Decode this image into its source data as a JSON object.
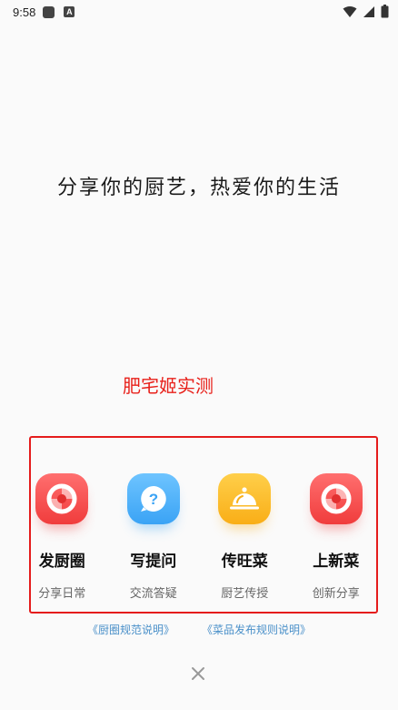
{
  "status_bar": {
    "time": "9:58",
    "notif_letter": "A"
  },
  "tagline": "分享你的厨艺，热爱你的生活",
  "watermark": "肥宅姬实测",
  "actions": [
    {
      "title": "发厨圈",
      "subtitle": "分享日常",
      "icon": "camera-aperture-icon",
      "color": "#f04848"
    },
    {
      "title": "写提问",
      "subtitle": "交流答疑",
      "icon": "question-bubble-icon",
      "color": "#3aa3f5"
    },
    {
      "title": "传旺菜",
      "subtitle": "厨艺传授",
      "icon": "food-cloche-icon",
      "color": "#f9ae17"
    },
    {
      "title": "上新菜",
      "subtitle": "创新分享",
      "icon": "camera-aperture-icon",
      "color": "#f04848"
    }
  ],
  "links": {
    "rules": "《厨圈规范说明》",
    "publish_rules": "《菜品发布规则说明》"
  }
}
